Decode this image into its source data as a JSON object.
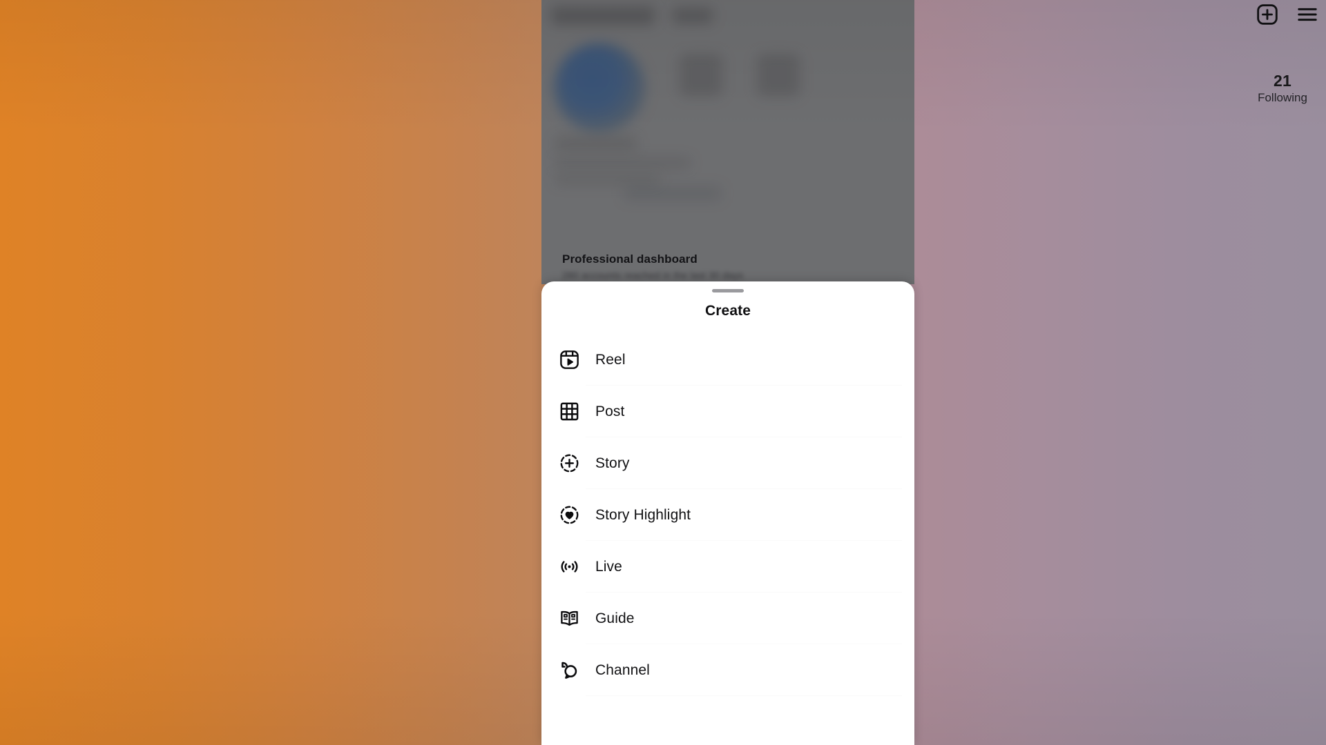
{
  "app": {
    "screen_name": "Instagram profile",
    "background_gradient": {
      "from": "#df8226",
      "mid": "#b3878f",
      "to": "#9a8e9e"
    }
  },
  "profile": {
    "top_actions": [
      {
        "name": "new-post-icon",
        "label": "New post",
        "glyph": "plus-square"
      },
      {
        "name": "menu-icon",
        "label": "Menu",
        "glyph": "hamburger"
      }
    ],
    "stats": {
      "following": {
        "count": "21",
        "label": "Following"
      }
    },
    "professional_dashboard": {
      "title": "Professional dashboard",
      "subtitle": ""
    }
  },
  "create_sheet": {
    "title": "Create",
    "grabber": "drag-handle",
    "items": [
      {
        "label": "Reel",
        "icon": "reel-icon"
      },
      {
        "label": "Post",
        "icon": "post-grid-icon"
      },
      {
        "label": "Story",
        "icon": "story-plus-icon"
      },
      {
        "label": "Story Highlight",
        "icon": "story-highlight-heart-icon"
      },
      {
        "label": "Live",
        "icon": "live-broadcast-icon"
      },
      {
        "label": "Guide",
        "icon": "guide-book-icon"
      },
      {
        "label": "Channel",
        "icon": "channel-bubbles-icon"
      }
    ]
  },
  "colors": {
    "sheet_background": "#ffffff",
    "text_primary": "#121214",
    "grabber": "#9a9a9e",
    "scrim": "rgba(72,72,74,0.46)"
  }
}
